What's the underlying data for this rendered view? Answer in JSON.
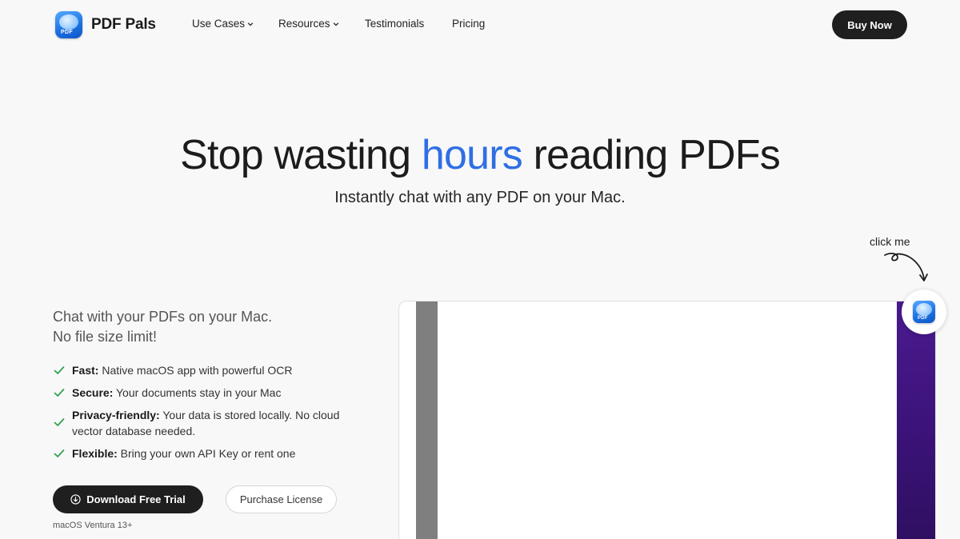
{
  "brand": {
    "name": "PDF Pals",
    "icon": "pdf-pals-app-icon",
    "icon_tag": "PDF"
  },
  "nav": {
    "items": [
      {
        "label": "Use Cases",
        "has_dropdown": true
      },
      {
        "label": "Resources",
        "has_dropdown": true
      },
      {
        "label": "Testimonials",
        "has_dropdown": false
      },
      {
        "label": "Pricing",
        "has_dropdown": false
      }
    ],
    "cta": "Buy Now"
  },
  "hero": {
    "title_before": "Stop wasting ",
    "title_highlight": "hours",
    "title_after": " reading PDFs",
    "subtitle": "Instantly chat with any PDF on your Mac."
  },
  "intro": {
    "line1": "Chat with your PDFs on your Mac.",
    "line2": "No file size limit!"
  },
  "features": [
    {
      "title": "Fast:",
      "text": " Native macOS app with powerful OCR"
    },
    {
      "title": "Secure:",
      "text": " Your documents stay in your Mac"
    },
    {
      "title": "Privacy-friendly:",
      "text": " Your data is stored locally. No cloud vector database needed."
    },
    {
      "title": "Flexible:",
      "text": " Bring your own API Key or rent one"
    }
  ],
  "actions": {
    "download": "Download Free Trial",
    "purchase": "Purchase License",
    "requirement": "macOS Ventura 13+"
  },
  "preview": {
    "hint": "click me",
    "launcher_tag": "PDF"
  },
  "colors": {
    "accent": "#2f6fe4",
    "dark_button": "#1f1f1f",
    "check": "#2e9e4f",
    "purple": "#3c137a",
    "background": "#f8f8f8"
  }
}
